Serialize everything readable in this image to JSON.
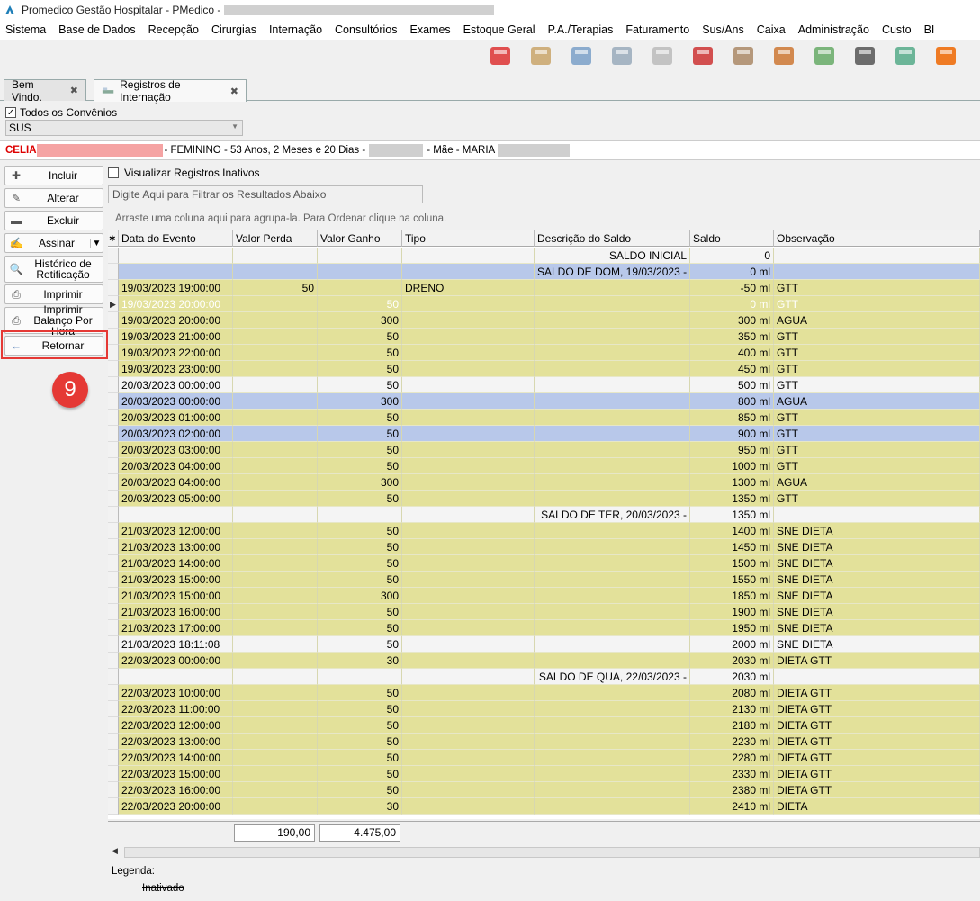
{
  "window": {
    "title": "Promedico Gestão Hospitalar - PMedico -"
  },
  "menu": [
    "Sistema",
    "Base de Dados",
    "Recepção",
    "Cirurgias",
    "Internação",
    "Consultórios",
    "Exames",
    "Estoque Geral",
    "P.A./Terapias",
    "Faturamento",
    "Sus/Ans",
    "Caixa",
    "Administração",
    "Custo",
    "BI"
  ],
  "toolbar_icons": [
    {
      "name": "users-refresh-icon",
      "color": "#d33"
    },
    {
      "name": "patient-card-icon",
      "color": "#c9a46a"
    },
    {
      "name": "doctor-icon",
      "color": "#7aa0c8"
    },
    {
      "name": "document-pen-icon",
      "color": "#9ab"
    },
    {
      "name": "ambulance-icon",
      "color": "#bbb"
    },
    {
      "name": "emergency-vehicle-icon",
      "color": "#c33"
    },
    {
      "name": "building-tools-icon",
      "color": "#a86"
    },
    {
      "name": "boxes-up-icon",
      "color": "#c73"
    },
    {
      "name": "money-down-icon",
      "color": "#6a6"
    },
    {
      "name": "safe-icon",
      "color": "#555"
    },
    {
      "name": "cash-register-icon",
      "color": "#5a8"
    },
    {
      "name": "phone-book-icon",
      "color": "#e60"
    }
  ],
  "tabs": [
    {
      "label": "Bem Vindo."
    },
    {
      "label": "Registros de Internação"
    }
  ],
  "filter": {
    "todos_convenios": "Todos os Convênios",
    "convenio": "SUS"
  },
  "patient": {
    "name": "CELIA",
    "info": "- FEMININO - 53 Anos, 2 Meses e 20 Dias -",
    "mae_label": "- Mãe - MARIA"
  },
  "sidebar": {
    "incluir": "Incluir",
    "alterar": "Alterar",
    "excluir": "Excluir",
    "assinar": "Assinar",
    "historico": "Histórico de Retificação",
    "imprimir": "Imprimir",
    "imprimir_balanco": "Imprimir Balanço Por Hora",
    "retornar": "Retornar",
    "badge": "9"
  },
  "main": {
    "inativos": "Visualizar Registros Inativos",
    "filter_placeholder": "Digite Aqui para Filtrar os Resultados Abaixo",
    "group_hint": "Arraste uma coluna aqui para agrupa-la. Para Ordenar clique na coluna."
  },
  "grid": {
    "columns": [
      "Data do Evento",
      "Valor Perda",
      "Valor Ganho",
      "Tipo",
      "Descrição do Saldo",
      "Saldo",
      "Observação"
    ],
    "rows": [
      {
        "t": "w",
        "d": "",
        "p": "",
        "g": "",
        "tipo": "",
        "desc": "SALDO INICIAL",
        "saldo": "0",
        "obs": ""
      },
      {
        "t": "b",
        "d": "",
        "p": "",
        "g": "",
        "tipo": "",
        "desc": "SALDO DE DOM, 19/03/2023 -",
        "saldo": "0 ml",
        "obs": ""
      },
      {
        "t": "y",
        "d": "19/03/2023 19:00:00",
        "p": "50",
        "g": "",
        "tipo": "DRENO",
        "desc": "",
        "saldo": "-50 ml",
        "obs": "GTT"
      },
      {
        "t": "i",
        "d": "19/03/2023 20:00:00",
        "p": "",
        "g": "50",
        "tipo": "",
        "desc": "",
        "saldo": "0 ml",
        "obs": "GTT"
      },
      {
        "t": "y",
        "d": "19/03/2023 20:00:00",
        "p": "",
        "g": "300",
        "tipo": "",
        "desc": "",
        "saldo": "300 ml",
        "obs": "AGUA"
      },
      {
        "t": "y",
        "d": "19/03/2023 21:00:00",
        "p": "",
        "g": "50",
        "tipo": "",
        "desc": "",
        "saldo": "350 ml",
        "obs": "GTT"
      },
      {
        "t": "y",
        "d": "19/03/2023 22:00:00",
        "p": "",
        "g": "50",
        "tipo": "",
        "desc": "",
        "saldo": "400 ml",
        "obs": "GTT"
      },
      {
        "t": "y",
        "d": "19/03/2023 23:00:00",
        "p": "",
        "g": "50",
        "tipo": "",
        "desc": "",
        "saldo": "450 ml",
        "obs": "GTT"
      },
      {
        "t": "w",
        "d": "20/03/2023 00:00:00",
        "p": "",
        "g": "50",
        "tipo": "",
        "desc": "",
        "saldo": "500 ml",
        "obs": "GTT"
      },
      {
        "t": "b",
        "d": "20/03/2023 00:00:00",
        "p": "",
        "g": "300",
        "tipo": "",
        "desc": "",
        "saldo": "800 ml",
        "obs": "AGUA"
      },
      {
        "t": "y",
        "d": "20/03/2023 01:00:00",
        "p": "",
        "g": "50",
        "tipo": "",
        "desc": "",
        "saldo": "850 ml",
        "obs": "GTT"
      },
      {
        "t": "b",
        "d": "20/03/2023 02:00:00",
        "p": "",
        "g": "50",
        "tipo": "",
        "desc": "",
        "saldo": "900 ml",
        "obs": "GTT"
      },
      {
        "t": "y",
        "d": "20/03/2023 03:00:00",
        "p": "",
        "g": "50",
        "tipo": "",
        "desc": "",
        "saldo": "950 ml",
        "obs": "GTT"
      },
      {
        "t": "y",
        "d": "20/03/2023 04:00:00",
        "p": "",
        "g": "50",
        "tipo": "",
        "desc": "",
        "saldo": "1000 ml",
        "obs": "GTT"
      },
      {
        "t": "y",
        "d": "20/03/2023 04:00:00",
        "p": "",
        "g": "300",
        "tipo": "",
        "desc": "",
        "saldo": "1300 ml",
        "obs": "AGUA"
      },
      {
        "t": "y",
        "d": "20/03/2023 05:00:00",
        "p": "",
        "g": "50",
        "tipo": "",
        "desc": "",
        "saldo": "1350 ml",
        "obs": "GTT"
      },
      {
        "t": "w",
        "d": "",
        "p": "",
        "g": "",
        "tipo": "",
        "desc": "SALDO DE TER, 20/03/2023 -",
        "saldo": "1350 ml",
        "obs": ""
      },
      {
        "t": "y",
        "d": "21/03/2023 12:00:00",
        "p": "",
        "g": "50",
        "tipo": "",
        "desc": "",
        "saldo": "1400 ml",
        "obs": "SNE DIETA"
      },
      {
        "t": "y",
        "d": "21/03/2023 13:00:00",
        "p": "",
        "g": "50",
        "tipo": "",
        "desc": "",
        "saldo": "1450 ml",
        "obs": "SNE DIETA"
      },
      {
        "t": "y",
        "d": "21/03/2023 14:00:00",
        "p": "",
        "g": "50",
        "tipo": "",
        "desc": "",
        "saldo": "1500 ml",
        "obs": "SNE DIETA"
      },
      {
        "t": "y",
        "d": "21/03/2023 15:00:00",
        "p": "",
        "g": "50",
        "tipo": "",
        "desc": "",
        "saldo": "1550 ml",
        "obs": "SNE DIETA"
      },
      {
        "t": "y",
        "d": "21/03/2023 15:00:00",
        "p": "",
        "g": "300",
        "tipo": "",
        "desc": "",
        "saldo": "1850 ml",
        "obs": "SNE DIETA"
      },
      {
        "t": "y",
        "d": "21/03/2023 16:00:00",
        "p": "",
        "g": "50",
        "tipo": "",
        "desc": "",
        "saldo": "1900 ml",
        "obs": "SNE DIETA"
      },
      {
        "t": "y",
        "d": "21/03/2023 17:00:00",
        "p": "",
        "g": "50",
        "tipo": "",
        "desc": "",
        "saldo": "1950 ml",
        "obs": "SNE DIETA"
      },
      {
        "t": "w",
        "d": "21/03/2023 18:11:08",
        "p": "",
        "g": "50",
        "tipo": "",
        "desc": "",
        "saldo": "2000 ml",
        "obs": "SNE DIETA"
      },
      {
        "t": "y",
        "d": "22/03/2023 00:00:00",
        "p": "",
        "g": "30",
        "tipo": "",
        "desc": "",
        "saldo": "2030 ml",
        "obs": "DIETA GTT"
      },
      {
        "t": "w",
        "d": "",
        "p": "",
        "g": "",
        "tipo": "",
        "desc": "SALDO DE QUA, 22/03/2023 -",
        "saldo": "2030 ml",
        "obs": ""
      },
      {
        "t": "y",
        "d": "22/03/2023 10:00:00",
        "p": "",
        "g": "50",
        "tipo": "",
        "desc": "",
        "saldo": "2080 ml",
        "obs": "DIETA GTT"
      },
      {
        "t": "y",
        "d": "22/03/2023 11:00:00",
        "p": "",
        "g": "50",
        "tipo": "",
        "desc": "",
        "saldo": "2130 ml",
        "obs": "DIETA GTT"
      },
      {
        "t": "y",
        "d": "22/03/2023 12:00:00",
        "p": "",
        "g": "50",
        "tipo": "",
        "desc": "",
        "saldo": "2180 ml",
        "obs": "DIETA GTT"
      },
      {
        "t": "y",
        "d": "22/03/2023 13:00:00",
        "p": "",
        "g": "50",
        "tipo": "",
        "desc": "",
        "saldo": "2230 ml",
        "obs": "DIETA GTT"
      },
      {
        "t": "y",
        "d": "22/03/2023 14:00:00",
        "p": "",
        "g": "50",
        "tipo": "",
        "desc": "",
        "saldo": "2280 ml",
        "obs": "DIETA GTT"
      },
      {
        "t": "y",
        "d": "22/03/2023 15:00:00",
        "p": "",
        "g": "50",
        "tipo": "",
        "desc": "",
        "saldo": "2330 ml",
        "obs": "DIETA GTT"
      },
      {
        "t": "y",
        "d": "22/03/2023 16:00:00",
        "p": "",
        "g": "50",
        "tipo": "",
        "desc": "",
        "saldo": "2380 ml",
        "obs": "DIETA GTT"
      },
      {
        "t": "y",
        "d": "22/03/2023 20:00:00",
        "p": "",
        "g": "30",
        "tipo": "",
        "desc": "",
        "saldo": "2410 ml",
        "obs": "DIETA"
      }
    ],
    "totals": {
      "perda": "190,00",
      "ganho": "4.475,00"
    }
  },
  "legend": {
    "label": "Legenda:",
    "inativado": "Inativado"
  },
  "colors": {
    "yellow": "#e3e19a",
    "blue": "#b8c8ea",
    "white": "#f4f4f4",
    "inactive_text": "#ffffff",
    "accent": "#e53935"
  }
}
